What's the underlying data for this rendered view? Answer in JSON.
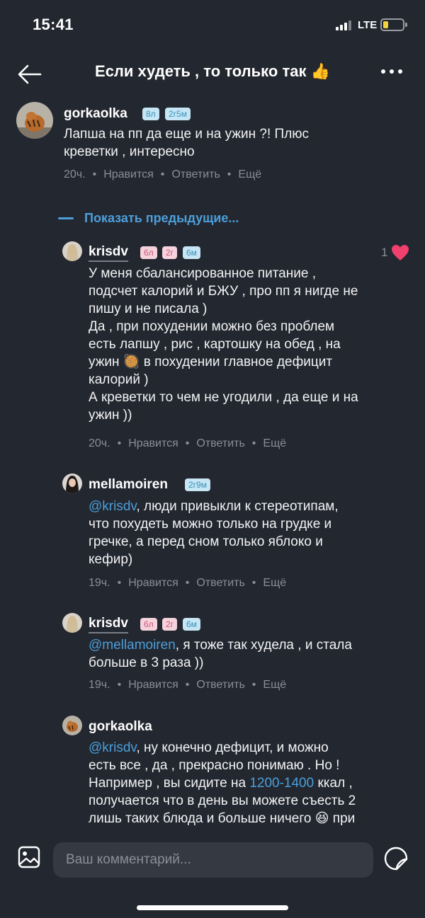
{
  "status": {
    "time": "15:41",
    "network": "LTE"
  },
  "header": {
    "title": "Если худеть , то только так 👍"
  },
  "top_comment": {
    "username": "gorkaolka",
    "badges": [
      "8л",
      "2г5м"
    ],
    "lines": [
      "Лапша на пп да еще и на ужин ?! Плюс",
      "креветки , интересно"
    ],
    "time": "20ч.",
    "like": "Нравится",
    "reply": "Ответить",
    "more": "Ещё"
  },
  "show_previous": "Показать предыдущие...",
  "replies": [
    {
      "username": "krisdv",
      "badges": [
        "6л",
        "2г",
        "6м"
      ],
      "likes": "1",
      "lines": [
        "У меня сбалансированное питание ,",
        "подсчет калорий и БЖУ , про пп я нигде не",
        "пишу и не писала )",
        "Да , при похудении можно без проблем",
        "есть лапшу , рис , картошку на обед , на",
        "ужин 🥘 в похудении главное дефицит",
        "калорий  )",
        "А креветки то чем не угодили , да еще и на",
        "ужин ))"
      ],
      "time": "20ч.",
      "like": "Нравится",
      "reply": "Ответить",
      "more": "Ещё"
    },
    {
      "username": "mellamoiren",
      "badges": [
        "2г9м"
      ],
      "mention": "@krisdv",
      "lines": [
        ", люди привыкли к стереотипам,",
        "что похудеть можно только на грудке и",
        "гречке, а перед сном только яблоко и",
        "кефир)"
      ],
      "time": "19ч.",
      "like": "Нравится",
      "reply": "Ответить",
      "more": "Ещё"
    },
    {
      "username": "krisdv",
      "badges": [
        "6л",
        "2г",
        "6м"
      ],
      "mention": "@mellamoiren",
      "lines": [
        ", я тоже так худела , и стала",
        "больше в 3 раза ))"
      ],
      "time": "19ч.",
      "like": "Нравится",
      "reply": "Ответить",
      "more": "Ещё"
    },
    {
      "username": "gorkaolka",
      "mention": "@krisdv",
      "lines": [
        ", ну конечно дефицит, и можно",
        "есть все , да , прекрасно понимаю . Но !",
        "Например , вы сидите на ",
        "1200-1400",
        " ккал ,",
        "получается что в день вы можете съесть 2",
        "лишь таких блюда и больше ничего 😆 при"
      ]
    }
  ],
  "composer": {
    "placeholder": "Ваш комментарий..."
  }
}
